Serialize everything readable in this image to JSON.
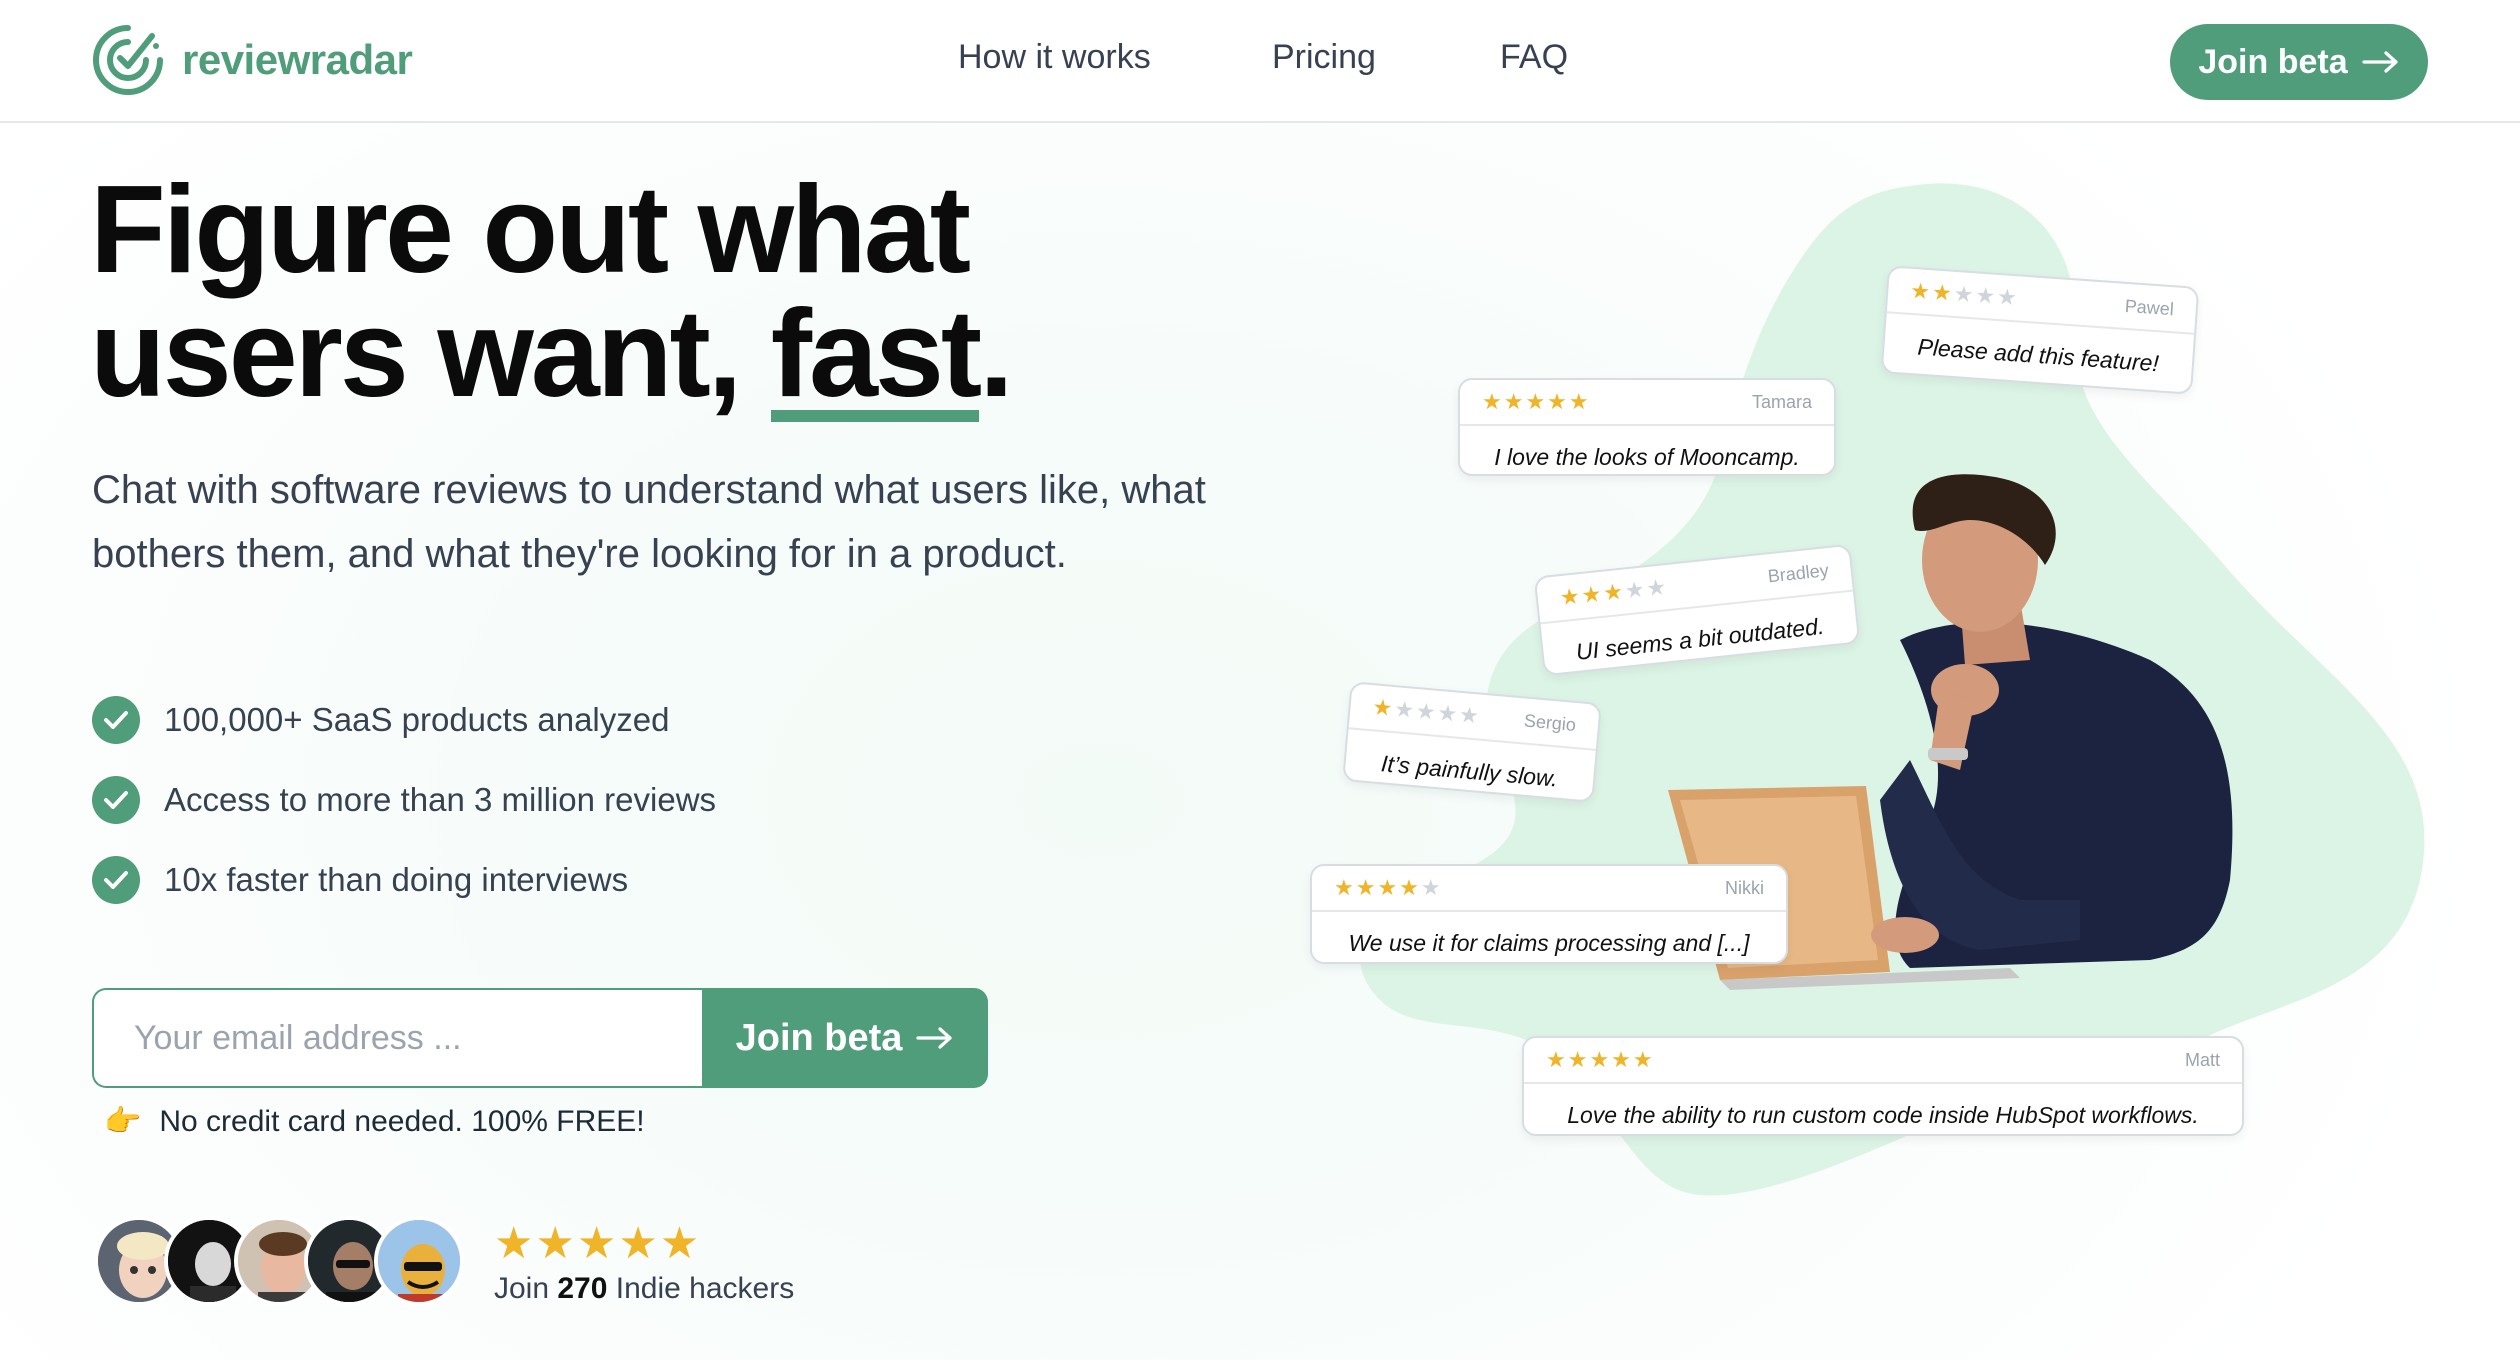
{
  "header": {
    "logo_text": "reviewradar",
    "nav": [
      {
        "label": "How it works"
      },
      {
        "label": "Pricing"
      },
      {
        "label": "FAQ"
      }
    ],
    "cta_label": "Join beta"
  },
  "hero": {
    "title_line1": "Figure out what",
    "title_line2_a": "users want, ",
    "title_line2_highlight": "fast",
    "title_line2_b": ".",
    "subtitle": "Chat with software reviews to understand what users like, what bothers them, and what they're looking for in a product.",
    "features": [
      "100,000+ SaaS products analyzed",
      "Access to more than 3 million reviews",
      "10x faster than doing interviews"
    ],
    "email_placeholder": "Your email address ...",
    "join_label": "Join beta",
    "note": "No credit card needed. 100% FREE!",
    "social": {
      "rating_stars": "★★★★★",
      "text_before": "Join ",
      "count": "270",
      "text_after": " Indie hackers"
    }
  },
  "reviews": [
    {
      "author": "Pawel",
      "rating": 2,
      "text": "Please add this feature!"
    },
    {
      "author": "Tamara",
      "rating": 5,
      "text": "I love the looks of Mooncamp."
    },
    {
      "author": "Bradley",
      "rating": 3,
      "text": "UI seems a bit outdated."
    },
    {
      "author": "Sergio",
      "rating": 1,
      "text": "It’s painfully slow."
    },
    {
      "author": "Nikki",
      "rating": 4,
      "text": "We use it for claims processing and [...]"
    },
    {
      "author": "Matt",
      "rating": 5,
      "text": "Love the ability to run custom code inside HubSpot workflows."
    }
  ],
  "colors": {
    "brand": "#4f9d7a",
    "blob": "#dff5ea",
    "star": "#f0b429"
  },
  "icons": {
    "logo": "radar-check-icon",
    "arrow": "arrow-right-icon",
    "check": "check-circle-icon",
    "note": "pointing-hand-icon"
  }
}
